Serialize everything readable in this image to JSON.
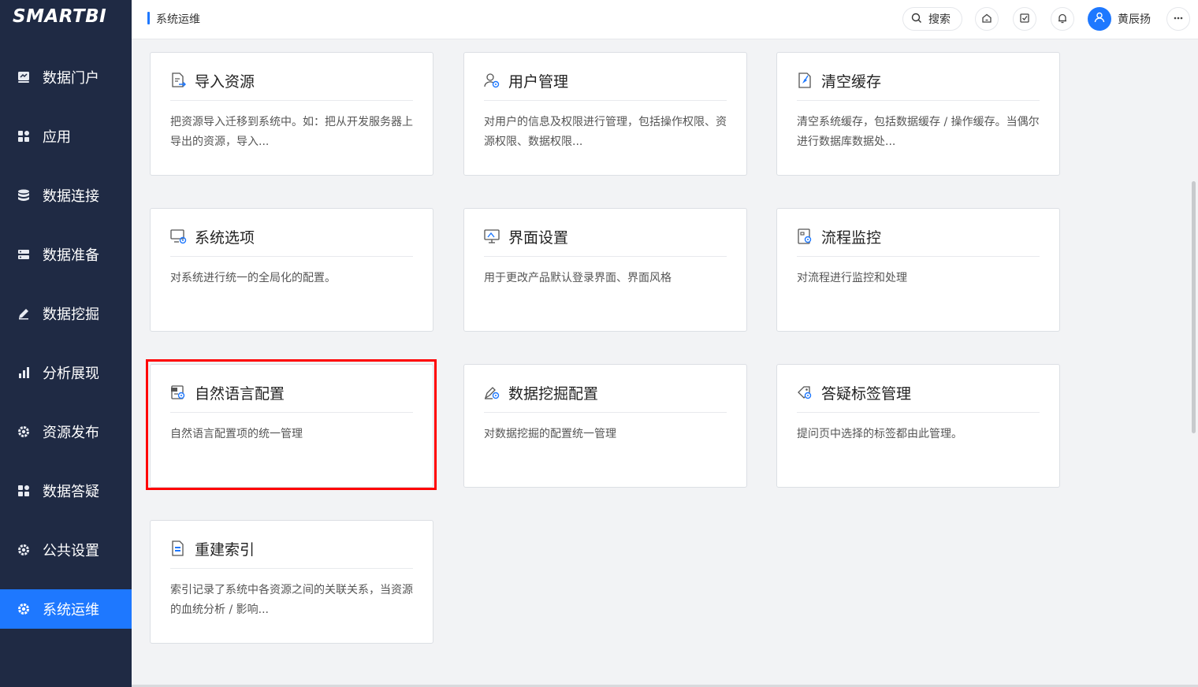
{
  "brand": "SMARTBI",
  "header": {
    "title": "系统运维",
    "search_label": "搜索",
    "username": "黄辰扬"
  },
  "sidebar": {
    "items": [
      {
        "label": "数据门户",
        "icon": "portal-icon"
      },
      {
        "label": "应用",
        "icon": "apps-icon"
      },
      {
        "label": "数据连接",
        "icon": "database-icon"
      },
      {
        "label": "数据准备",
        "icon": "server-icon"
      },
      {
        "label": "数据挖掘",
        "icon": "pencil-icon"
      },
      {
        "label": "分析展现",
        "icon": "bar-chart-icon"
      },
      {
        "label": "资源发布",
        "icon": "gear-icon"
      },
      {
        "label": "数据答疑",
        "icon": "apps-icon"
      },
      {
        "label": "公共设置",
        "icon": "gear-icon"
      },
      {
        "label": "系统运维",
        "icon": "gear-icon",
        "active": true
      }
    ]
  },
  "cards": [
    {
      "title": "导入资源",
      "desc": "把资源导入迁移到系统中。如：把从开发服务器上导出的资源，导入...",
      "icon": "import-icon"
    },
    {
      "title": "用户管理",
      "desc": "对用户的信息及权限进行管理，包括操作权限、资源权限、数据权限...",
      "icon": "user-settings-icon"
    },
    {
      "title": "清空缓存",
      "desc": "清空系统缓存，包括数据缓存 / 操作缓存。当偶尔进行数据库数据处...",
      "icon": "clear-cache-icon"
    },
    {
      "title": "系统选项",
      "desc": "对系统进行统一的全局化的配置。",
      "icon": "monitor-gear-icon"
    },
    {
      "title": "界面设置",
      "desc": "用于更改产品默认登录界面、界面风格",
      "icon": "display-icon"
    },
    {
      "title": "流程监控",
      "desc": "对流程进行监控和处理",
      "icon": "flow-monitor-icon"
    },
    {
      "title": "自然语言配置",
      "desc": "自然语言配置项的统一管理",
      "icon": "nlp-config-icon"
    },
    {
      "title": "数据挖掘配置",
      "desc": "对数据挖掘的配置统一管理",
      "icon": "mining-config-icon"
    },
    {
      "title": "答疑标签管理",
      "desc": "提问页中选择的标签都由此管理。",
      "icon": "tag-icon"
    },
    {
      "title": "重建索引",
      "desc": "索引记录了系统中各资源之间的关联关系，当资源的血统分析 / 影响...",
      "icon": "index-doc-icon"
    }
  ]
}
